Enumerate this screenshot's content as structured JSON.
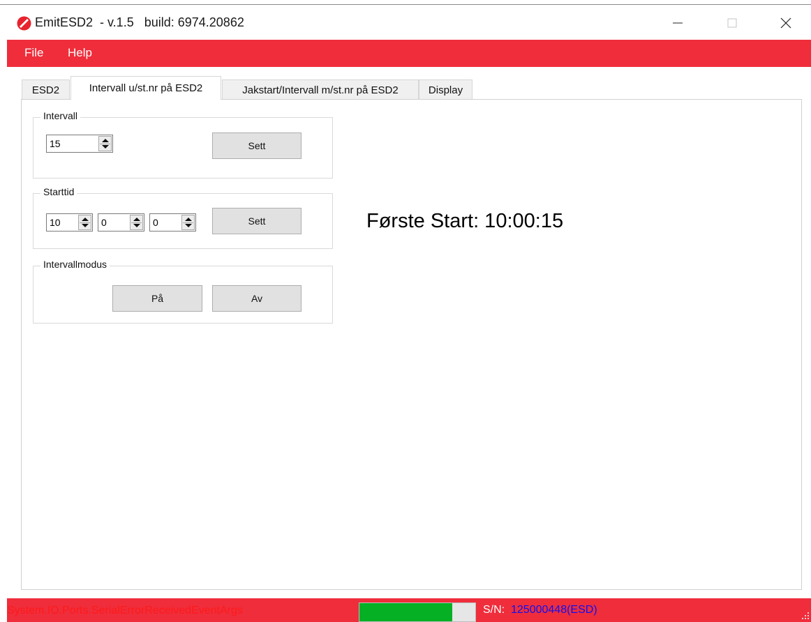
{
  "window": {
    "title": "EmitESD2  - v.1.5   build: 6974.20862",
    "icon": "emit-logo-icon",
    "controls": [
      "minimize-icon",
      "maximize-icon",
      "close-icon"
    ]
  },
  "menu": {
    "items": [
      {
        "label": "File"
      },
      {
        "label": "Help"
      }
    ]
  },
  "tabs": [
    {
      "label": "ESD2"
    },
    {
      "label": "Intervall u/st.nr på ESD2",
      "active": true
    },
    {
      "label": "Jakstart/Intervall m/st.nr på ESD2"
    },
    {
      "label": "Display"
    }
  ],
  "intervall": {
    "title": "Intervall",
    "value": "15",
    "set_label": "Sett"
  },
  "starttid": {
    "title": "Starttid",
    "hours": "10",
    "minutes": "0",
    "seconds": "0",
    "set_label": "Sett"
  },
  "intervallmodus": {
    "title": "Intervallmodus",
    "on_label": "På",
    "off_label": "Av"
  },
  "first_start": "Første Start: 10:00:15",
  "status": {
    "message": "System.IO.Ports.SerialErrorReceivedEventArgs",
    "progress_fraction": 0.8,
    "sn_label": "S/N:",
    "sn_value": "125000448(ESD)"
  },
  "colors": {
    "accent": "#ef2d3b",
    "progress": "#06b025",
    "serial": "#1010f0"
  }
}
